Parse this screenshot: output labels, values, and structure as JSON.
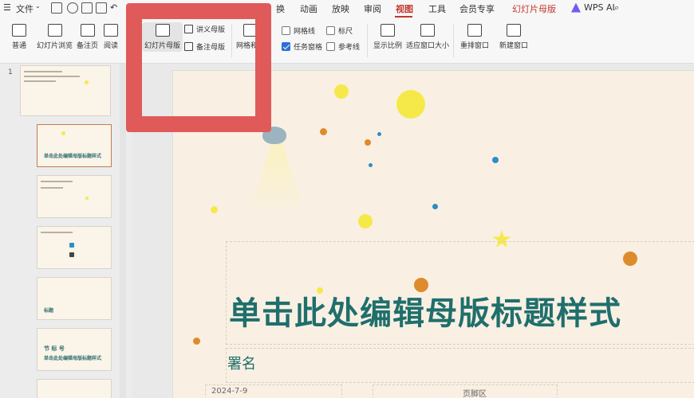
{
  "menubar": {
    "file_label": "文件",
    "items": [
      "换",
      "动画",
      "放映",
      "审阅",
      "视图",
      "工具",
      "会员专享",
      "幻灯片母版"
    ],
    "active_item": "视图",
    "wps_ai_label": "WPS AI"
  },
  "ribbon": {
    "normal": "普通",
    "slide_browse": "幻灯片浏览",
    "notes_page": "备注页",
    "reading": "阅读",
    "slide_master": "幻灯片母版",
    "handout_master": "讲义母版",
    "notes_master": "备注母版",
    "grid_and_guides": "网格和参",
    "gridlines": "网格线",
    "ruler": "标尺",
    "task_pane": "任务窗格",
    "guides": "参考线",
    "zoom": "显示比例",
    "fit_window": "适应窗口大小",
    "arrange_window": "重排窗口",
    "new_window": "新建窗口",
    "checkbox_states": {
      "gridlines": false,
      "ruler": false,
      "task_pane": true,
      "guides": false
    }
  },
  "thumbnails": {
    "slide_number": "1",
    "thumb2_title": "单击此处编辑母版标题样式",
    "thumb5_label": "标题",
    "thumb6_label": "节 标 号",
    "thumb6_sub": "单击此处编辑母版标题样式"
  },
  "slide": {
    "title": "单击此处编辑母版标题样式",
    "subtitle": "署名",
    "date": "2024-7-9",
    "footer": "页脚区"
  },
  "colors": {
    "accent": "#c0392b",
    "title_teal": "#1f6f6c",
    "highlight_red": "#e05a5a",
    "dot_yellow": "#f5e94a",
    "dot_orange": "#de8b2c",
    "dot_blue": "#2b8fc4"
  }
}
